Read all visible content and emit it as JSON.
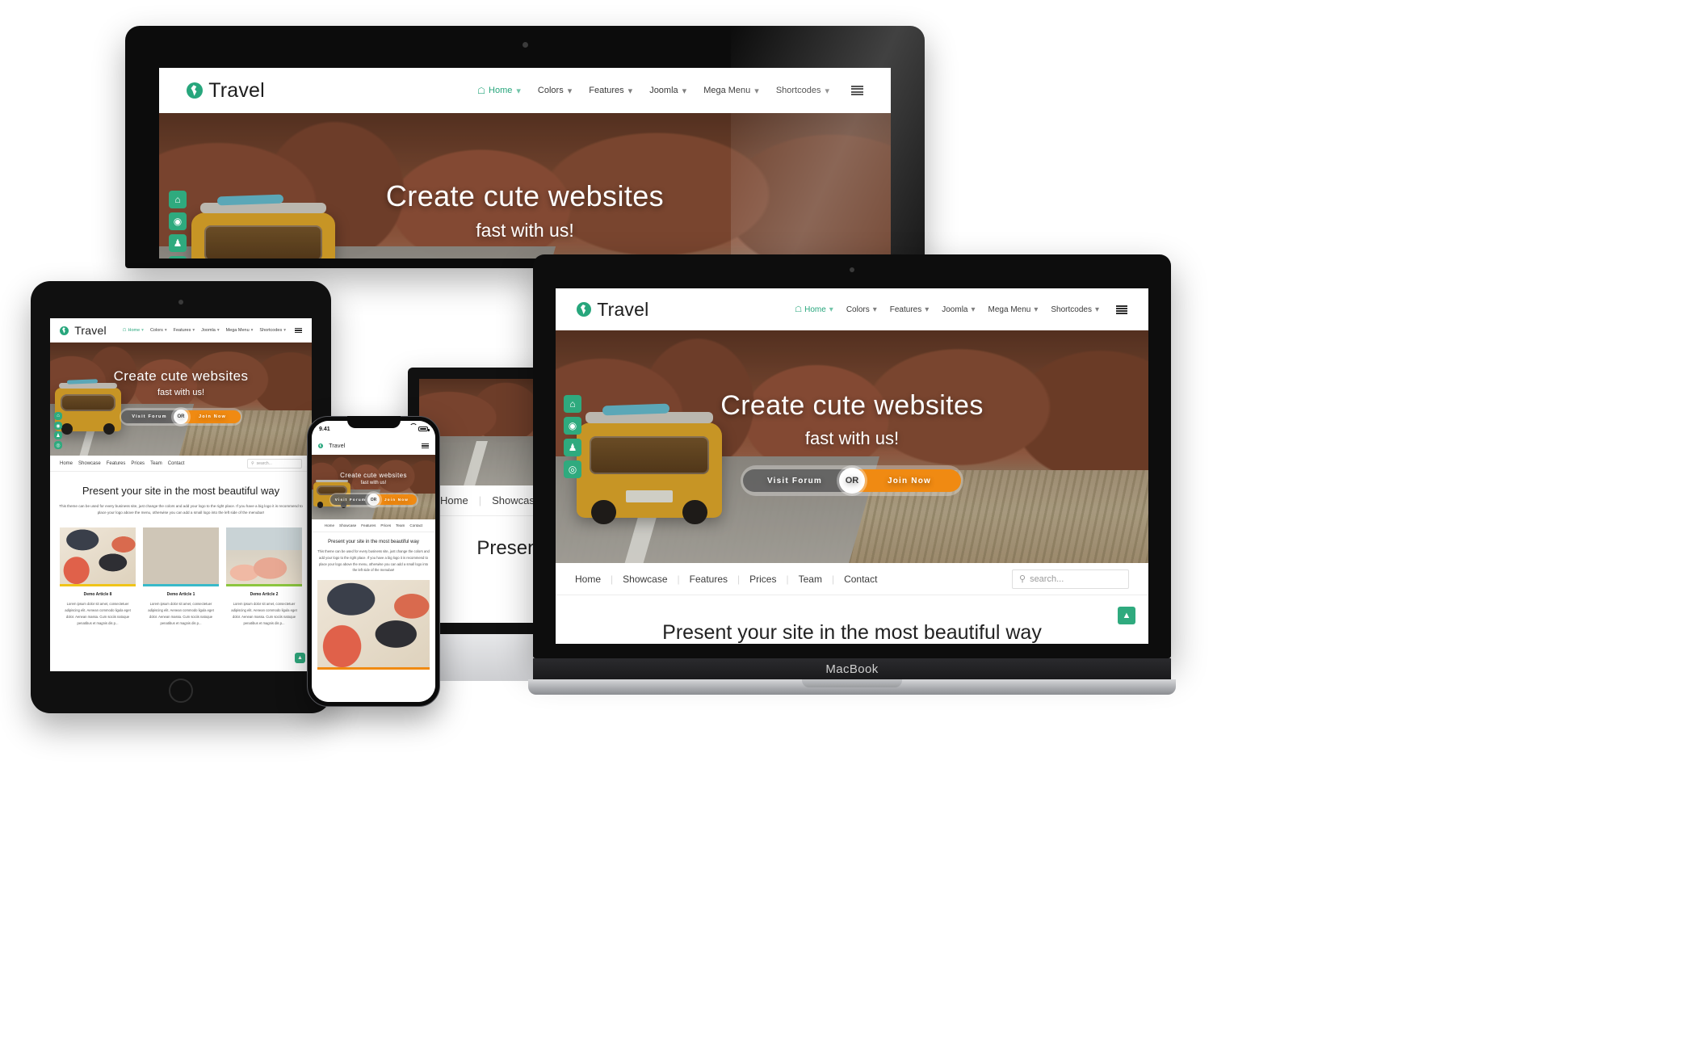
{
  "site": {
    "brand": "Travel",
    "brand_icon": "globe-icon",
    "colors": {
      "accent_green": "#27a67c",
      "cta_orange": "#f08a12",
      "cta_grey": "#555555",
      "card_bar_yellow": "#f0c419",
      "card_bar_cyan": "#39b9c9",
      "card_bar_green": "#8cc63f"
    },
    "main_nav": [
      {
        "label": "Home",
        "icon": "home-icon",
        "active": true,
        "caret": true
      },
      {
        "label": "Colors",
        "active": false,
        "caret": true
      },
      {
        "label": "Features",
        "active": false,
        "caret": true
      },
      {
        "label": "Joomla",
        "active": false,
        "caret": true
      },
      {
        "label": "Mega Menu",
        "active": false,
        "caret": true
      },
      {
        "label": "Shortcodes",
        "active": false,
        "caret": true
      }
    ],
    "menu_toggle_icon": "hamburger-icon",
    "hero": {
      "title": "Create cute websites",
      "subtitle": "fast with us!",
      "btn_left": "Visit Forum",
      "btn_or": "OR",
      "btn_right": "Join Now"
    },
    "side_icons": [
      {
        "name": "home-icon",
        "glyph": "⌂"
      },
      {
        "name": "globe-icon",
        "glyph": "♁"
      },
      {
        "name": "user-icon",
        "glyph": "♟"
      },
      {
        "name": "location-pin-icon",
        "glyph": "⌖"
      }
    ],
    "sub_nav": [
      "Home",
      "Showcase",
      "Features",
      "Prices",
      "Team",
      "Contact"
    ],
    "search_placeholder": "search...",
    "search_icon": "search-icon",
    "content": {
      "heading": "Present your site in the most beautiful way",
      "paragraph": "This theme can be used for every business site, just change the colors and add your logo to the right place. If you have a big logo it is recommend to place your logo above the menu, otherwise you can add a small logo into the left side of the menubar!"
    },
    "cards": [
      {
        "title": "Demo Article 8",
        "text": "Lorem ipsum dolor sit amet, consectetuer adipiscing elit. Aenean commodo ligula eget dolor. Aenean massa. Cum sociis natoque penatibus et magnis dis p...",
        "image_name": "travel-gear-flatlay-image",
        "bar_color": "#f0c419"
      },
      {
        "title": "Demo Article 1",
        "text": "Lorem ipsum dolor sit amet, consectetuer adipiscing elit. Aenean commodo ligula eget dolor. Aenean massa. Cum sociis natoque penatibus et magnis dis p...",
        "image_name": "desert-road-van-image",
        "bar_color": "#39b9c9"
      },
      {
        "title": "Demo Article 2",
        "text": "Lorem ipsum dolor sit amet, consectetuer adipiscing elit. Aenean commodo ligula eget dolor. Aenean massa. Cum sociis natoque penatibus et magnis dis p...",
        "image_name": "beach-sunbathers-image",
        "bar_color": "#8cc63f"
      }
    ],
    "scroll_top_icon": "chevron-up-icon"
  },
  "devices": {
    "laptop": {
      "name": "laptop"
    },
    "macbook": {
      "name": "macbook",
      "label": "MacBook"
    },
    "tablet": {
      "name": "tablet"
    },
    "imac": {
      "name": "imac",
      "logo": "apple-logo"
    },
    "phone": {
      "name": "phone",
      "status_time": "9.41",
      "wifi_icon": "wifi-icon",
      "battery_icon": "battery-icon"
    }
  }
}
